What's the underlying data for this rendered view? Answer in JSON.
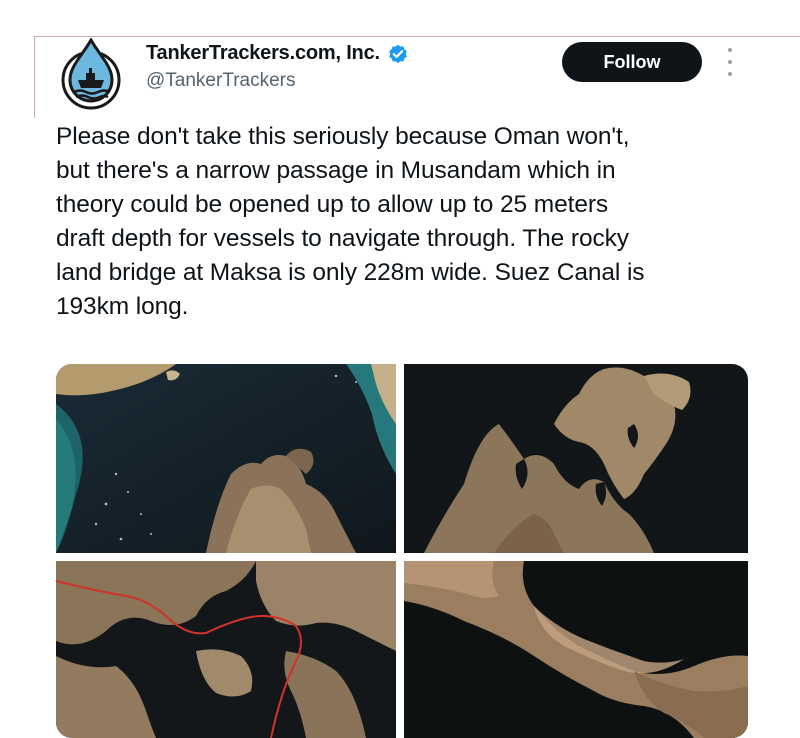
{
  "account": {
    "display_name": "TankerTrackers.com, Inc.",
    "handle": "@TankerTrackers",
    "avatar_icon": "water-drop-ship-logo",
    "verified_icon": "verified-badge-icon",
    "verified_color": "#1d9bf0"
  },
  "actions": {
    "follow_label": "Follow",
    "more_icon": "more-vertical-icon"
  },
  "tweet": {
    "text": "Please don't take this seriously because Oman won't,\nbut there's a narrow passage in Musandam which in\ntheory could be opened up to allow up to 25 meters\ndraft depth for vessels to navigate through. The rocky\nland bridge at Maksa is only 228m wide. Suez Canal is\n193km long."
  },
  "media": {
    "images": [
      {
        "name": "satellite-image-musandam-overview"
      },
      {
        "name": "satellite-image-musandam-inlets"
      },
      {
        "name": "satellite-image-route-through-passage"
      },
      {
        "name": "satellite-image-maksa-land-bridge"
      }
    ],
    "route_color": "#d0322c"
  }
}
